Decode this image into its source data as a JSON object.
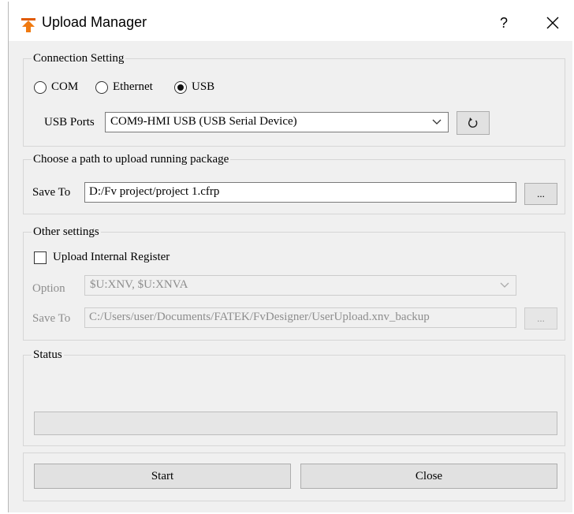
{
  "window": {
    "title": "Upload Manager",
    "help": "?"
  },
  "connection": {
    "legend": "Connection Setting",
    "options": [
      {
        "label": "COM",
        "selected": false
      },
      {
        "label": "Ethernet",
        "selected": false
      },
      {
        "label": "USB",
        "selected": true
      }
    ],
    "usb_ports_label": "USB Ports",
    "usb_port_value": "COM9-HMI USB (USB Serial Device)"
  },
  "path": {
    "legend": "Choose a path to upload running package",
    "save_to_label": "Save To",
    "save_to_value": "D:/Fv project/project 1.cfrp",
    "browse_label": "..."
  },
  "other": {
    "legend": "Other settings",
    "upload_internal_register_label": "Upload Internal Register",
    "upload_internal_register_checked": false,
    "option_label": "Option",
    "option_value": "$U:XNV, $U:XNVA",
    "save_to_label": "Save To",
    "save_to_value": "C:/Users/user/Documents/FATEK/FvDesigner/UserUpload.xnv_backup",
    "browse_label": "..."
  },
  "status": {
    "legend": "Status",
    "progress": 0
  },
  "buttons": {
    "start": "Start",
    "close": "Close"
  }
}
